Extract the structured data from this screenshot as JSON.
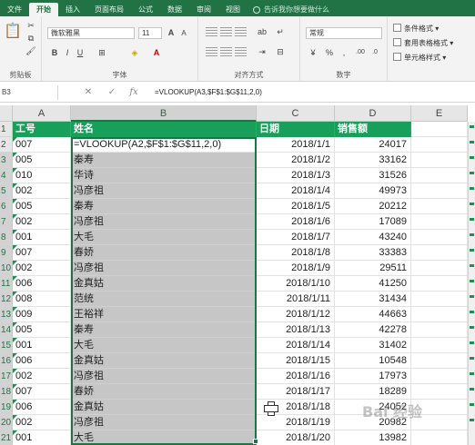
{
  "ribbon": {
    "tabs": [
      "文件",
      "开始",
      "插入",
      "页面布局",
      "公式",
      "数据",
      "审阅",
      "视图"
    ],
    "active_tab": "开始",
    "tell_me": "告诉我你想要做什么",
    "groups": {
      "clipboard": "剪贴板",
      "font": "字体",
      "alignment": "对齐方式",
      "number": "数字",
      "styles": [
        "条件格式",
        "套用表格格式",
        "单元格样式"
      ]
    },
    "font_name": "微软雅黑",
    "font_size": "11",
    "number_format": "常规",
    "number_symbols": [
      "%",
      ","
    ]
  },
  "formula_bar": {
    "name_box": "B3",
    "fx": "fx",
    "formula": "=VLOOKUP(A3,$F$1:$G$11,2,0)"
  },
  "sheet": {
    "columns": [
      "A",
      "B",
      "C",
      "D",
      "E"
    ],
    "selected_column": "B",
    "headers": {
      "id": "工号",
      "name": "姓名",
      "date": "日期",
      "sales": "销售额"
    },
    "editing_formula": "=VLOOKUP(A2,$F$1:$G$11,2,0)",
    "rows": [
      {
        "num": "2",
        "id": "007",
        "name": "",
        "date": "2018/1/1",
        "sales": "24017"
      },
      {
        "num": "3",
        "id": "005",
        "name": "秦寿",
        "date": "2018/1/2",
        "sales": "33162"
      },
      {
        "num": "4",
        "id": "010",
        "name": "华诗",
        "date": "2018/1/3",
        "sales": "31526"
      },
      {
        "num": "5",
        "id": "002",
        "name": "冯彦祖",
        "date": "2018/1/4",
        "sales": "49973"
      },
      {
        "num": "6",
        "id": "005",
        "name": "秦寿",
        "date": "2018/1/5",
        "sales": "20212"
      },
      {
        "num": "7",
        "id": "002",
        "name": "冯彦祖",
        "date": "2018/1/6",
        "sales": "17089"
      },
      {
        "num": "8",
        "id": "001",
        "name": "大毛",
        "date": "2018/1/7",
        "sales": "43240"
      },
      {
        "num": "9",
        "id": "007",
        "name": "春娇",
        "date": "2018/1/8",
        "sales": "33383"
      },
      {
        "num": "10",
        "id": "002",
        "name": "冯彦祖",
        "date": "2018/1/9",
        "sales": "29511"
      },
      {
        "num": "11",
        "id": "006",
        "name": "金真姑",
        "date": "2018/1/10",
        "sales": "41250"
      },
      {
        "num": "12",
        "id": "008",
        "name": "范统",
        "date": "2018/1/11",
        "sales": "31434"
      },
      {
        "num": "13",
        "id": "009",
        "name": "王裕祥",
        "date": "2018/1/12",
        "sales": "44663"
      },
      {
        "num": "14",
        "id": "005",
        "name": "秦寿",
        "date": "2018/1/13",
        "sales": "42278"
      },
      {
        "num": "15",
        "id": "001",
        "name": "大毛",
        "date": "2018/1/14",
        "sales": "31402"
      },
      {
        "num": "16",
        "id": "006",
        "name": "金真姑",
        "date": "2018/1/15",
        "sales": "10548"
      },
      {
        "num": "17",
        "id": "002",
        "name": "冯彦祖",
        "date": "2018/1/16",
        "sales": "17973"
      },
      {
        "num": "18",
        "id": "007",
        "name": "春娇",
        "date": "2018/1/17",
        "sales": "18289"
      },
      {
        "num": "19",
        "id": "006",
        "name": "金真姑",
        "date": "2018/1/18",
        "sales": "24052"
      },
      {
        "num": "20",
        "id": "002",
        "name": "冯彦祖",
        "date": "2018/1/19",
        "sales": "20982"
      },
      {
        "num": "21",
        "id": "001",
        "name": "大毛",
        "date": "2018/1/20",
        "sales": "13982"
      }
    ]
  },
  "watermark": "Bai 经验",
  "colors": {
    "accent": "#217346",
    "header_fill": "#18a05a",
    "selection_fill": "#c6c6c6"
  },
  "icons": [
    "paste-icon",
    "cut-icon",
    "copy-icon",
    "format-painter-icon",
    "bold-icon",
    "italic-icon",
    "underline-icon",
    "fill-color-icon",
    "font-color-icon",
    "cancel-icon",
    "enter-icon",
    "function-icon",
    "move-cursor-icon",
    "lightbulb-icon"
  ]
}
